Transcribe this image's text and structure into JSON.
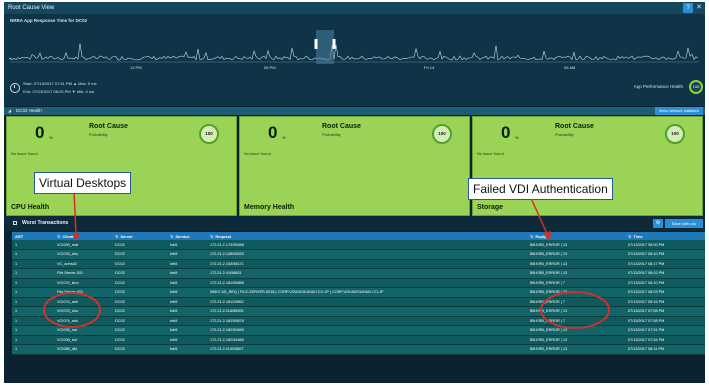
{
  "window": {
    "title": "Root Cause View",
    "help_icon": "question-icon",
    "close_icon": "close-icon"
  },
  "timeline": {
    "title": "NRBA App Response Time for DC02",
    "tick_labels": [
      "12 PM",
      "06 PM",
      "Fri 14",
      "06 AM"
    ],
    "start": "Start: 07/13/2017 07:51 PM",
    "max": "Max: 5 ms",
    "end": "End: 07/13/2017 08:20 PM",
    "min": "Min: 0 ms",
    "perf_label": "App Performance Health",
    "perf_value": "100"
  },
  "health_section": {
    "title": "DC02 Health",
    "link": "View network statistics"
  },
  "cards": [
    {
      "value": "0",
      "unit": "%",
      "root_cause": "Root Cause",
      "probability": "Probability",
      "issue": "No issue found",
      "score": "100",
      "caption": "CPU Health"
    },
    {
      "value": "0",
      "unit": "%",
      "root_cause": "Root Cause",
      "probability": "Probability",
      "issue": "No issue found",
      "score": "100",
      "caption": "Memory Health"
    },
    {
      "value": "0",
      "unit": "%",
      "root_cause": "Root Cause",
      "probability": "Probability",
      "issue": "No issue found",
      "score": "100",
      "caption": "Storage"
    }
  ],
  "worst": {
    "title": "Worst Transactions",
    "save_label": "Save with csv"
  },
  "table": {
    "headers": [
      "ART",
      "Client",
      "Server",
      "Service",
      "Request",
      "Reply",
      "Time"
    ],
    "rows": [
      [
        "1",
        "VCI005_mat",
        "DC02",
        "krb5",
        "172.21.2.173/95068",
        "BB:KRB_ERROR | 13",
        "07/13/2017 08:00 PM"
      ],
      [
        "1",
        "VCI076_vbu",
        "DC02",
        "krb5",
        "172.21.2.128/05093",
        "BB:KRB_ERROR | 13",
        "07/13/2017 08:10 PM"
      ],
      [
        "1",
        "VC_anhsd2",
        "DC02",
        "krb5",
        "172.21.2.153/58171",
        "BB:KRB_ERROR | 13",
        "07/13/2017 08:17 PM"
      ],
      [
        "1",
        "File-Server-001",
        "DC02",
        "krb5",
        "172.21.2.41/58801",
        "BB:KRB_ERROR | 13",
        "07/13/2017 08:02 PM"
      ],
      [
        "1",
        "VCI074_ikun",
        "DC02",
        "krb5",
        "172.21.2.181/55888",
        "BB:KRB_ERROR | 7",
        "07/13/2017 08:10 PM"
      ],
      [
        "1",
        "File-Server-001",
        "DC02",
        "krb5",
        "59807 AS_REQ | FILE-SERVER-001$ | CORP.VOUNDSUKAKI.CO.JP | CORP.VOUNDSUKAKI.CO.JP",
        "BB:KRB_ERROR | 25",
        "07/13/2017 08:03 PM"
      ],
      [
        "1",
        "VCI074_ank",
        "DC02",
        "krb5",
        "172.21.2.181/29852",
        "BB:KRB_ERROR | 7",
        "07/13/2017 08:16 PM"
      ],
      [
        "1",
        "VCI076_vbu",
        "DC02",
        "krb5",
        "172.21.2.118/55305",
        "BB:KRB_ERROR | 13",
        "07/13/2017 07:55 PM"
      ],
      [
        "1",
        "VCI074_ank",
        "DC02",
        "krb5",
        "172.21.2.181/59878",
        "BB:KRB_ERROR | 7",
        "07/13/2017 07:58 PM"
      ],
      [
        "1",
        "VCI005_nar",
        "DC02",
        "krb5",
        "172.21.2.162/50845",
        "BB:KRB_ERROR | 13",
        "07/13/2017 07:51 PM"
      ],
      [
        "1",
        "VCI008_bol",
        "DC02",
        "krb5",
        "172.21.2.162/54466",
        "BB:KRB_ERROR | 13",
        "07/13/2017 07:54 PM"
      ],
      [
        "1",
        "VCI085_dkt",
        "DC02",
        "krb5",
        "172.21.2.119/03607",
        "BB:KRB_ERROR | 13",
        "07/13/2017 08:11 PM"
      ]
    ]
  },
  "annotations": {
    "left": "Virtual Desktops",
    "right": "Failed VDI Authentication",
    "color": "#d0312d"
  },
  "colors": {
    "card_green": "#9ad356",
    "header_blue": "#1f78b8",
    "row_teal": "#0f5a5c"
  }
}
